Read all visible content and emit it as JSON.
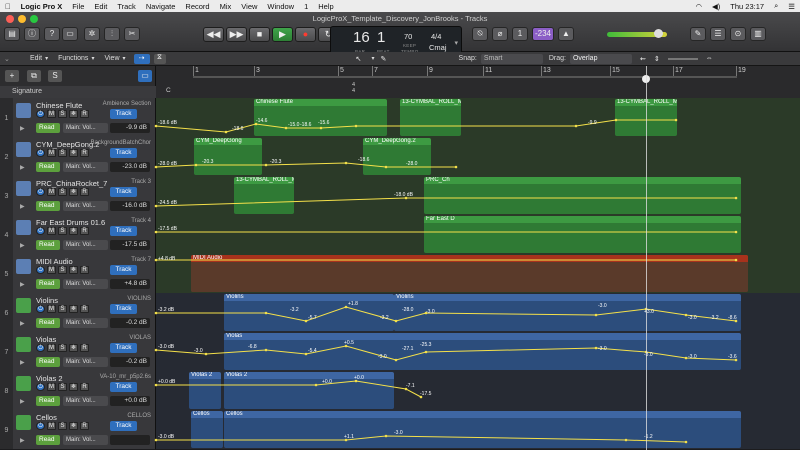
{
  "menubar": {
    "items": [
      "Logic Pro X",
      "File",
      "Edit",
      "Track",
      "Navigate",
      "Record",
      "Mix",
      "View",
      "Window",
      "1",
      "Help"
    ],
    "clock": "Thu 23:17"
  },
  "window": {
    "title": "LogicProX_Template_Discovery_JonBrooks - Tracks"
  },
  "lcd": {
    "bar": "16",
    "beat": "1",
    "bar_label": "BAR",
    "beat_label": "BEAT",
    "tempo": "70",
    "tempo_label": "TEMPO",
    "keep_label": "KEEP",
    "signature": "4/4",
    "key": "Cmaj",
    "cpu_label": "‑234"
  },
  "toolbar2": {
    "edit": "Edit",
    "functions": "Functions",
    "view": "View",
    "snap_label": "Snap:",
    "snap_value": "Smart",
    "drag_label": "Drag:",
    "drag_value": "Overlap"
  },
  "signature_row": "Signature",
  "ruler": {
    "bars": [
      "1",
      "3",
      "5",
      "7",
      "9",
      "11",
      "13",
      "15",
      "17",
      "19"
    ],
    "sig_marker": "4\n4",
    "key_marker": "C"
  },
  "tracks": [
    {
      "num": "1",
      "name": "Chinese Flute",
      "sub": "Ambience Section",
      "mode": "Read",
      "param": "Main: Vol...",
      "value": "-9.9 dB",
      "track_label": "Track",
      "icon_color": "#5c7fb4"
    },
    {
      "num": "2",
      "name": "CYM_DeepGong.2",
      "sub": "BackgroundBatchChor",
      "mode": "Read",
      "param": "Main: Vol...",
      "value": "-23.0 dB",
      "track_label": "Track",
      "icon_color": "#5c7fb4"
    },
    {
      "num": "3",
      "name": "PRC_ChinaRocket_7",
      "sub": "Track 3",
      "mode": "Read",
      "param": "Main: Vol...",
      "value": "-16.0 dB",
      "track_label": "Track",
      "icon_color": "#5c7fb4"
    },
    {
      "num": "4",
      "name": "Far East Drums 01.6",
      "sub": "Track 4",
      "mode": "Read",
      "param": "Main: Vol...",
      "value": "-17.5 dB",
      "track_label": "Track",
      "icon_color": "#5c7fb4"
    },
    {
      "num": "5",
      "name": "MIDI Audio",
      "sub": "Track 7",
      "mode": "Read",
      "param": "Main: Vol...",
      "value": "+4.8 dB",
      "track_label": "Track",
      "icon_color": "#5c7fb4"
    },
    {
      "num": "6",
      "name": "Violins",
      "sub": "VIOLINS",
      "mode": "Read",
      "param": "Main: Vol...",
      "value": "-0.2 dB",
      "track_label": "Track",
      "icon_color": "#4aa04a"
    },
    {
      "num": "7",
      "name": "Violas",
      "sub": "VIOLAS",
      "mode": "Read",
      "param": "Main: Vol...",
      "value": "-0.2 dB",
      "track_label": "Track",
      "icon_color": "#4aa04a"
    },
    {
      "num": "8",
      "name": "Violas 2",
      "sub": "VA-10_mr_p5p2.6s",
      "mode": "Read",
      "param": "Main: Vol...",
      "value": "+0.0 dB",
      "track_label": "Track",
      "icon_color": "#4aa04a"
    },
    {
      "num": "9",
      "name": "Cellos",
      "sub": "CELLOS",
      "mode": "Read",
      "param": "Main: Vol...",
      "value": "",
      "track_label": "Track",
      "icon_color": "#4aa04a"
    }
  ],
  "regions": [
    {
      "track": 0,
      "label": "Chinese Flute",
      "type": "audio"
    },
    {
      "track": 0,
      "label": "13-CYMBAL_ROLL_M",
      "type": "audio"
    },
    {
      "track": 0,
      "label": "13-CYMBAL_ROLL_M",
      "type": "audio"
    },
    {
      "track": 1,
      "label": "CYM_DeepGong",
      "type": "audio"
    },
    {
      "track": 1,
      "label": "CYM_DeepGong.2",
      "type": "audio"
    },
    {
      "track": 2,
      "label": "13-CYMBAL_ROLL_M",
      "type": "audio"
    },
    {
      "track": 2,
      "label": "PRC_Ch",
      "type": "audio"
    },
    {
      "track": 3,
      "label": "Far East D",
      "type": "audio"
    },
    {
      "track": 4,
      "label": "MIDI Audio",
      "type": "midi-audio"
    },
    {
      "track": 4,
      "label": "MIDI Audio",
      "type": "midi-audio"
    },
    {
      "track": 5,
      "label": "Violins",
      "type": "midi"
    },
    {
      "track": 5,
      "label": "Violins",
      "type": "midi"
    },
    {
      "track": 6,
      "label": "Violas",
      "type": "midi"
    },
    {
      "track": 7,
      "label": "Violas 2",
      "type": "midi"
    },
    {
      "track": 7,
      "label": "Violas 2",
      "type": "midi"
    },
    {
      "track": 8,
      "label": "Cellos",
      "type": "midi"
    },
    {
      "track": 8,
      "label": "Cellos",
      "type": "midi"
    }
  ],
  "automation_labels": [
    [
      "-18.6 dB",
      "-18.6",
      "-14.6",
      "-15.0",
      "-18.6",
      "-15.6",
      "-9.9"
    ],
    [
      "-28.0 dB",
      "-20.3",
      "-20.3",
      "-18.6",
      "-28.0"
    ],
    [
      "-24.5 dB",
      "-18.0 dB"
    ],
    [
      "-17.5 dB"
    ],
    [
      "+4.8 dB"
    ],
    [
      "-3.2 dB",
      "-3.2",
      "-5.7",
      "+1.8",
      "-3.2",
      "-28.0",
      "-3.0",
      "-3.0",
      "+3.0",
      "-3.0",
      "-3.2",
      "-8.6"
    ],
    [
      "-3.0 dB",
      "-3.0",
      "-6.8",
      "-5.4",
      "+0.5",
      "-3.0",
      "-27.1",
      "-25.3",
      "-3.0",
      "-3.0",
      "-3.0",
      "-3.6"
    ],
    [
      "+0.0 dB",
      "+0.0",
      "+0.0",
      "-7.1",
      "-17.5"
    ],
    [
      "-3.0 dB",
      "+1.1",
      "-3.0",
      "-1.2"
    ]
  ],
  "colors": {
    "audio_region": "#2f7a34",
    "audio_region_header": "#3d9a42",
    "midi_region": "#2c4d7c",
    "midi_region_header": "#3e66a3",
    "midi_audio_region": "#a8321c",
    "automation": "#f4e04a",
    "track_button": "#2f6fbd",
    "read_button": "#5ca03d"
  }
}
